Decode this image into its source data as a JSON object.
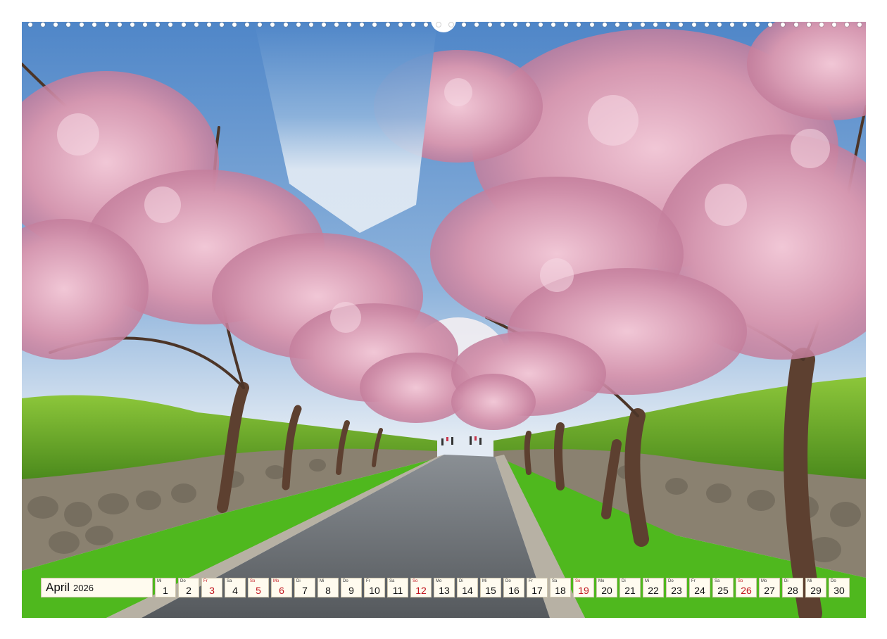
{
  "calendar": {
    "month": "April",
    "year": "2026",
    "days": [
      {
        "wd": "Mi",
        "d": "1",
        "red": false
      },
      {
        "wd": "Do",
        "d": "2",
        "red": false
      },
      {
        "wd": "Fr",
        "d": "3",
        "red": true
      },
      {
        "wd": "Sa",
        "d": "4",
        "red": false
      },
      {
        "wd": "So",
        "d": "5",
        "red": true
      },
      {
        "wd": "Mo",
        "d": "6",
        "red": true
      },
      {
        "wd": "Di",
        "d": "7",
        "red": false
      },
      {
        "wd": "Mi",
        "d": "8",
        "red": false
      },
      {
        "wd": "Do",
        "d": "9",
        "red": false
      },
      {
        "wd": "Fr",
        "d": "10",
        "red": false
      },
      {
        "wd": "Sa",
        "d": "11",
        "red": false
      },
      {
        "wd": "So",
        "d": "12",
        "red": true
      },
      {
        "wd": "Mo",
        "d": "13",
        "red": false
      },
      {
        "wd": "Di",
        "d": "14",
        "red": false
      },
      {
        "wd": "Mi",
        "d": "15",
        "red": false
      },
      {
        "wd": "Do",
        "d": "16",
        "red": false
      },
      {
        "wd": "Fr",
        "d": "17",
        "red": false
      },
      {
        "wd": "Sa",
        "d": "18",
        "red": false
      },
      {
        "wd": "So",
        "d": "19",
        "red": true
      },
      {
        "wd": "Mo",
        "d": "20",
        "red": false
      },
      {
        "wd": "Di",
        "d": "21",
        "red": false
      },
      {
        "wd": "Mi",
        "d": "22",
        "red": false
      },
      {
        "wd": "Do",
        "d": "23",
        "red": false
      },
      {
        "wd": "Fr",
        "d": "24",
        "red": false
      },
      {
        "wd": "Sa",
        "d": "25",
        "red": false
      },
      {
        "wd": "So",
        "d": "26",
        "red": true
      },
      {
        "wd": "Mo",
        "d": "27",
        "red": false
      },
      {
        "wd": "Di",
        "d": "28",
        "red": false
      },
      {
        "wd": "Mi",
        "d": "29",
        "red": false
      },
      {
        "wd": "Do",
        "d": "30",
        "red": false
      }
    ]
  },
  "colors": {
    "sky_top": "#4f86c8",
    "sky_bottom": "#dfe9f5",
    "blossom": "#d9a0b6",
    "blossom_dark": "#b77593",
    "hedge": "#6fae2a",
    "grass": "#4fb81e",
    "stone_wall": "#7d7466",
    "road": "#5f6468",
    "sunday_red": "#c0141c"
  }
}
